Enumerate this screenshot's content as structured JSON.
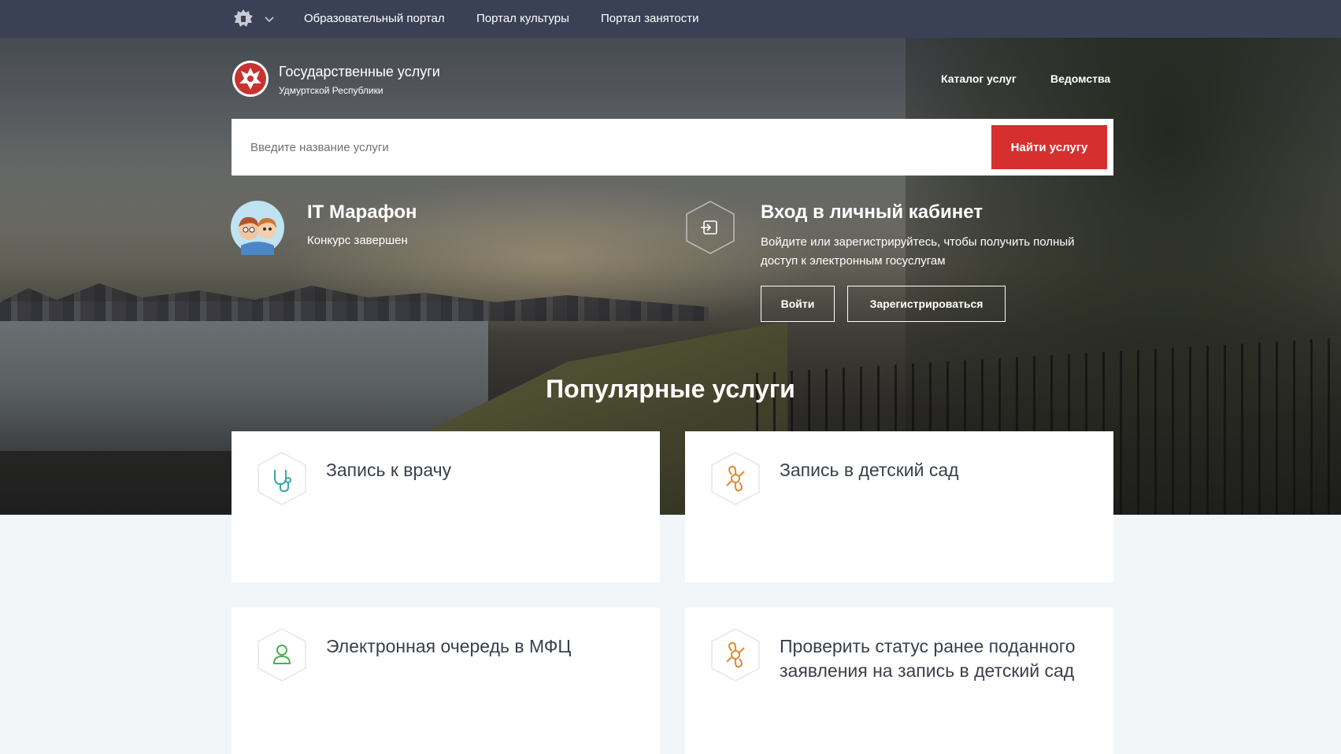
{
  "topbar": {
    "links": [
      "Образовательный портал",
      "Портал культуры",
      "Портал занятости"
    ]
  },
  "header": {
    "title": "Государственные услуги",
    "subtitle": "Удмуртской Республики",
    "nav": [
      "Каталог услуг",
      "Ведомства"
    ]
  },
  "search": {
    "placeholder": "Введите название услуги",
    "button_label": "Найти услугу"
  },
  "promo": {
    "title": "IT Марафон",
    "status": "Конкурс завершен"
  },
  "login": {
    "title": "Вход в личный кабинет",
    "description": "Войдите или зарегистрируйтесь, чтобы получить полный доступ к электронным госуслугам",
    "login_label": "Войти",
    "register_label": "Зарегистрироваться"
  },
  "popular": {
    "title": "Популярные услуги",
    "cards": [
      {
        "label": "Запись к врачу",
        "icon": "stethoscope-icon"
      },
      {
        "label": "Запись в детский сад",
        "icon": "pacifier-icon"
      },
      {
        "label": "Электронная очередь в МФЦ",
        "icon": "person-icon"
      },
      {
        "label": "Проверить статус ранее поданного заявления на запись в детский сад",
        "icon": "pacifier-icon"
      }
    ]
  },
  "colors": {
    "topbar": "#3a4156",
    "accent_red": "#d5302f",
    "icon_teal": "#3aa6a8",
    "icon_orange": "#e08a2a",
    "icon_green": "#4caf50",
    "page_bg": "#f3f6f8"
  }
}
